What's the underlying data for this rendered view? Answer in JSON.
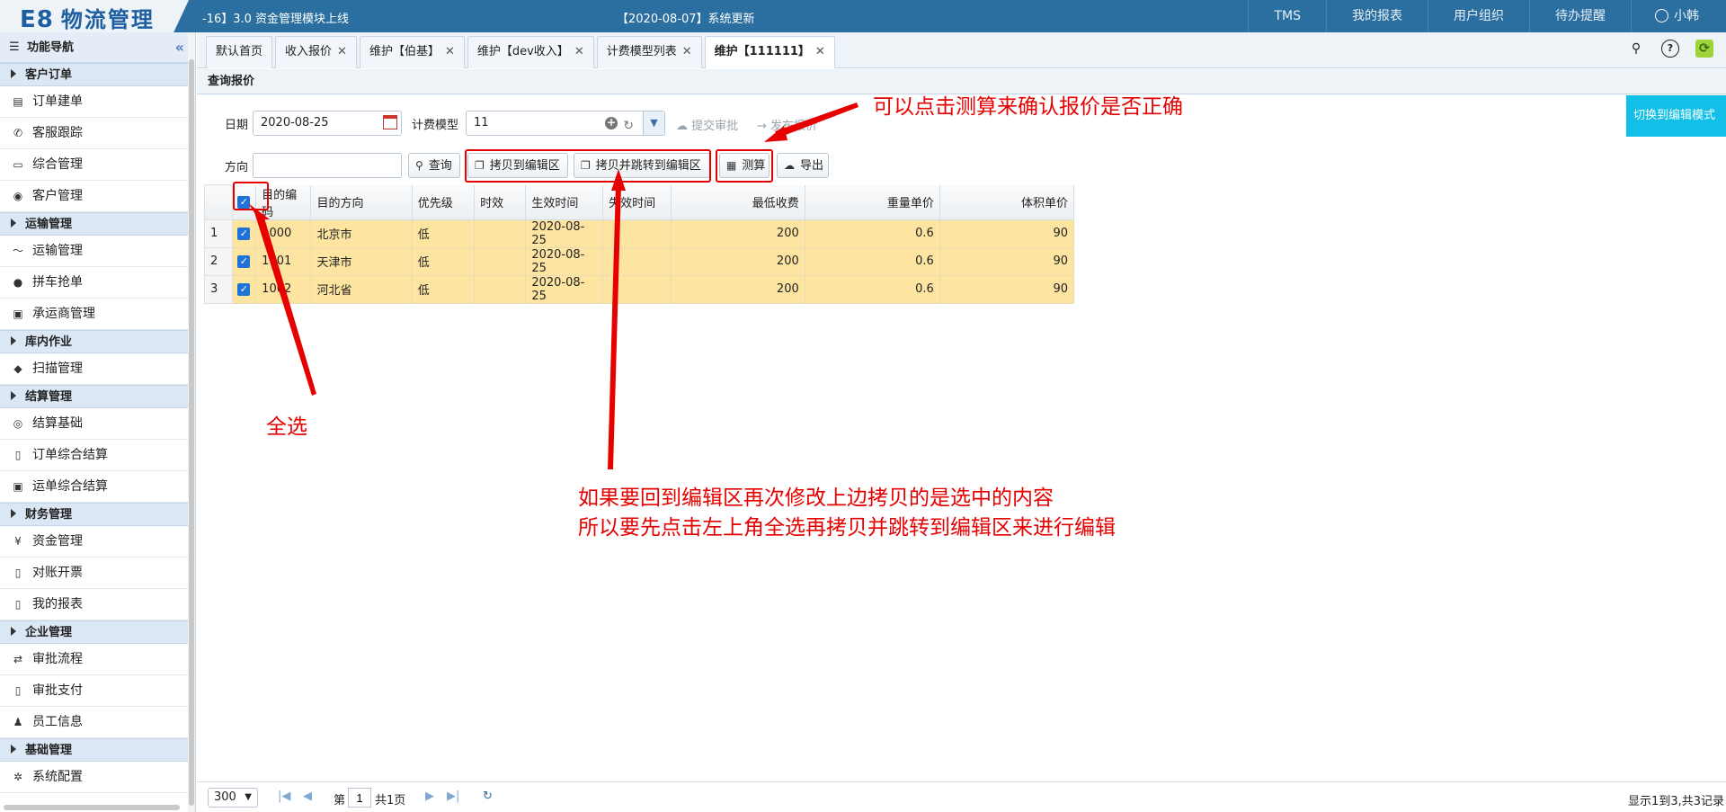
{
  "topbar": {
    "logo_latin": "E8",
    "logo_cn": "物流管理",
    "notice_left": "-16】3.0 资金管理模块上线",
    "notice_center": "【2020-08-07】系统更新",
    "nav": [
      "TMS",
      "我的报表",
      "用户组织",
      "待办提醒"
    ],
    "user": "小韩"
  },
  "sidebar": {
    "title": "功能导航",
    "collapse": "«",
    "groups": [
      {
        "label": "客户订单",
        "items": [
          "订单建单",
          "客服跟踪",
          "综合管理",
          "客户管理"
        ]
      },
      {
        "label": "运输管理",
        "items": [
          "运输管理",
          "拼车抢单",
          "承运商管理"
        ]
      },
      {
        "label": "库内作业",
        "items": [
          "扫描管理"
        ]
      },
      {
        "label": "结算管理",
        "items": [
          "结算基础",
          "订单综合结算",
          "运单综合结算"
        ]
      },
      {
        "label": "财务管理",
        "items": [
          "资金管理",
          "对账开票",
          "我的报表"
        ]
      },
      {
        "label": "企业管理",
        "items": [
          "审批流程",
          "审批支付",
          "员工信息"
        ]
      },
      {
        "label": "基础管理",
        "items": [
          "系统配置"
        ]
      }
    ]
  },
  "tabs": [
    {
      "label": "默认首页",
      "closable": false
    },
    {
      "label": "收入报价",
      "closable": true
    },
    {
      "label": "维护【伯基】",
      "closable": true
    },
    {
      "label": "维护【dev收入】",
      "closable": true
    },
    {
      "label": "计费模型列表",
      "closable": true
    },
    {
      "label": "维护【111111】",
      "closable": true,
      "active": true
    }
  ],
  "panel": {
    "title": "查询报价",
    "date_label": "日期",
    "date_value": "2020-08-25",
    "model_label": "计费模型",
    "model_value": "11",
    "submit_approval": "提交审批",
    "publish_quote": "发布报价",
    "direction_label": "方向",
    "direction_value": "",
    "query_btn": "查询",
    "copy_btn": "拷贝到编辑区",
    "copy_jump_btn": "拷贝并跳转到编辑区",
    "calc_btn": "测算",
    "export_btn": "导出",
    "switch_btn": "切换到编辑模式"
  },
  "grid": {
    "columns": [
      "目的编码",
      "目的方向",
      "优先级",
      "时效",
      "生效时间",
      "失效时间",
      "最低收费",
      "重量单价",
      "体积单价"
    ],
    "rows": [
      {
        "n": "1",
        "code": "1000",
        "dest": "北京市",
        "pri": "低",
        "aging": "",
        "eff": "2020-08-25",
        "exp": "",
        "min": "200",
        "wt": "0.6",
        "vol": "90"
      },
      {
        "n": "2",
        "code": "1001",
        "dest": "天津市",
        "pri": "低",
        "aging": "",
        "eff": "2020-08-25",
        "exp": "",
        "min": "200",
        "wt": "0.6",
        "vol": "90"
      },
      {
        "n": "3",
        "code": "1002",
        "dest": "河北省",
        "pri": "低",
        "aging": "",
        "eff": "2020-08-25",
        "exp": "",
        "min": "200",
        "wt": "0.6",
        "vol": "90"
      }
    ]
  },
  "annotations": {
    "select_all": "全选",
    "calc_hint": "可以点击测算来确认报价是否正确",
    "copy_hint_1": "如果要回到编辑区再次修改上边拷贝的是选中的内容",
    "copy_hint_2": "所以要先点击左上角全选再拷贝并跳转到编辑区来进行编辑"
  },
  "pager": {
    "page_size": "300",
    "page_prefix": "第",
    "page_value": "1",
    "page_total": "共1页",
    "info": "显示1到3,共3记录"
  },
  "colors": {
    "accent": "#2a6fa0",
    "annotation": "#e60000",
    "row_selected": "#fde4a0",
    "switch": "#12bfe8"
  }
}
